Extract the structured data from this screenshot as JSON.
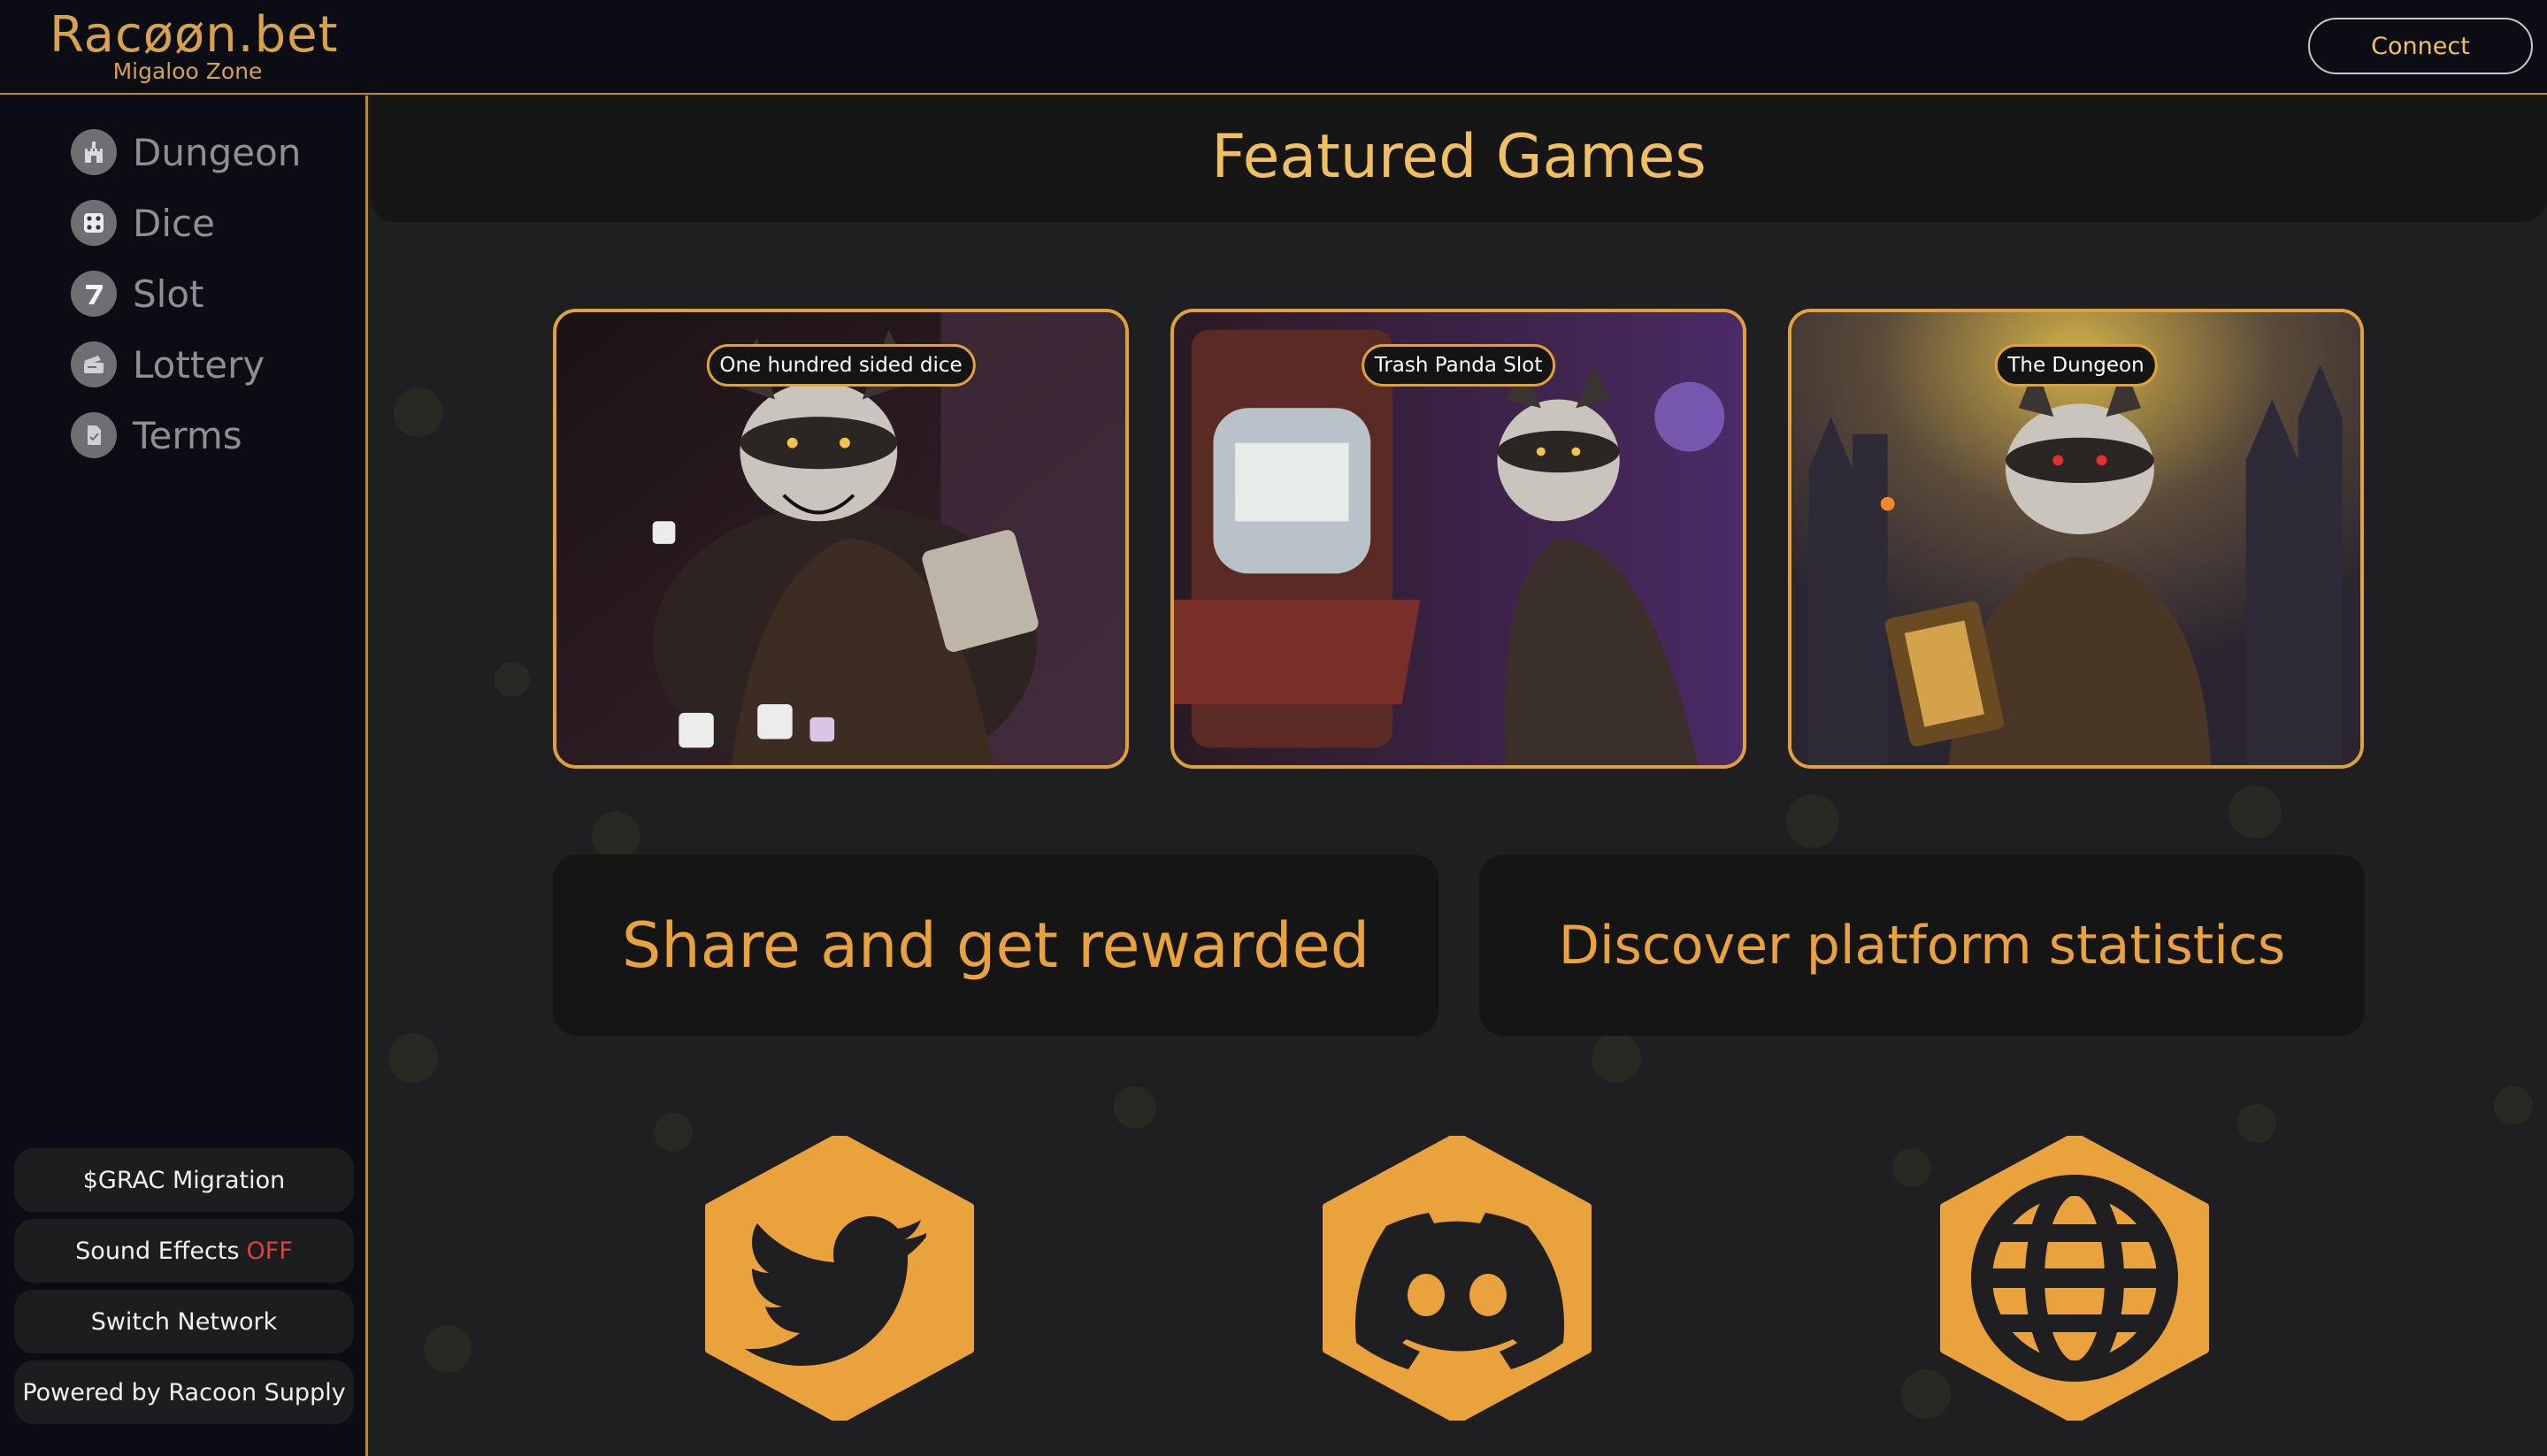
{
  "header": {
    "logo_title": "Racøøn.bet",
    "logo_subtitle": "Migaloo Zone",
    "connect_label": "Connect"
  },
  "sidebar": {
    "items": [
      {
        "label": "Dungeon",
        "icon": "castle-icon"
      },
      {
        "label": "Dice",
        "icon": "dice-icon"
      },
      {
        "label": "Slot",
        "icon": "seven-icon"
      },
      {
        "label": "Lottery",
        "icon": "ticket-icon"
      },
      {
        "label": "Terms",
        "icon": "document-icon"
      }
    ],
    "bottom": {
      "migration": "$GRAC Migration",
      "sound_prefix": "Sound Effects",
      "sound_state": "OFF",
      "switch_network": "Switch Network",
      "powered_by": "Powered by Racoon Supply"
    }
  },
  "main": {
    "featured_title": "Featured Games",
    "games": [
      {
        "label": "One hundred sided dice"
      },
      {
        "label": "Trash Panda Slot"
      },
      {
        "label": "The Dungeon"
      }
    ],
    "promos": {
      "share": "Share and get rewarded",
      "stats": "Discover platform statistics"
    },
    "socials": [
      "twitter-icon",
      "discord-icon",
      "globe-icon"
    ]
  },
  "colors": {
    "accent": "#e0a13a",
    "title_gold": "#f0c060",
    "sidebar_bg": "#0c0d14",
    "main_bg": "#1f1f21",
    "off_red": "#e0413a"
  }
}
